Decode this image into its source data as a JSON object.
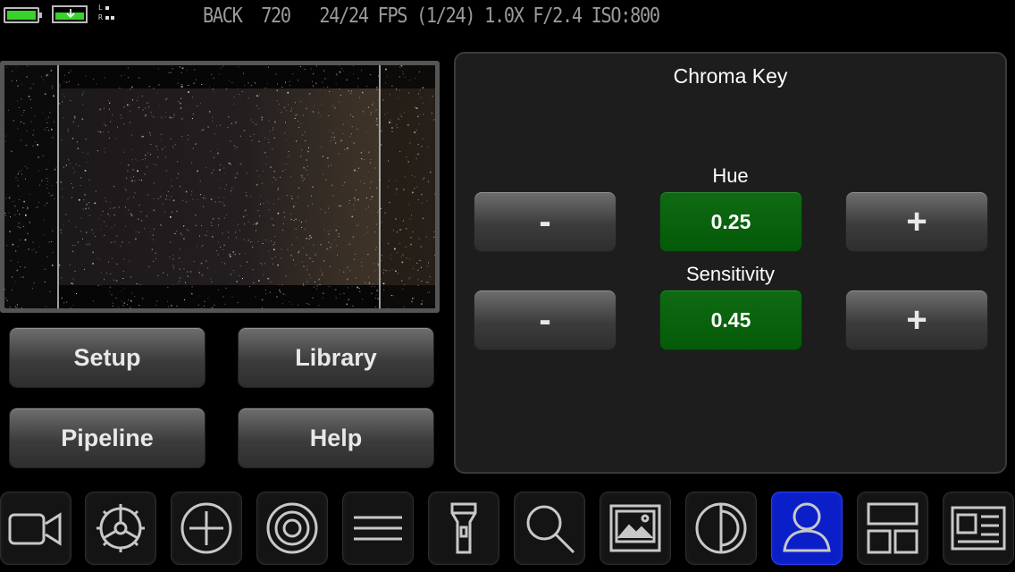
{
  "status_bar": {
    "battery_icon": "battery-icon",
    "storage_icon": "storage-icon",
    "audio_meter_icon": "audio-meter-icon",
    "audio_meter_labels": [
      "L",
      "R"
    ],
    "info_text": "BACK  720   24/24 FPS (1/24) 1.0X F/2.4 ISO:800",
    "colors": {
      "battery": "#39d12c",
      "storage": "#39d12c",
      "text": "#9a9a9a"
    }
  },
  "preview": {
    "name": "camera-preview"
  },
  "buttons": {
    "setup": "Setup",
    "library": "Library",
    "pipeline": "Pipeline",
    "help": "Help"
  },
  "chroma_key": {
    "title": "Chroma Key",
    "hue": {
      "label": "Hue",
      "value": "0.25",
      "decrement": "-",
      "increment": "+"
    },
    "sensitivity": {
      "label": "Sensitivity",
      "value": "0.45",
      "decrement": "-",
      "increment": "+"
    },
    "value_color": "#0a6410"
  },
  "toolbar": {
    "items": [
      {
        "icon": "video-camera-icon",
        "active": false
      },
      {
        "icon": "gear-icon",
        "active": false
      },
      {
        "icon": "plus-circle-icon",
        "active": false
      },
      {
        "icon": "target-icon",
        "active": false
      },
      {
        "icon": "menu-lines-icon",
        "active": false
      },
      {
        "icon": "flashlight-icon",
        "active": false
      },
      {
        "icon": "search-icon",
        "active": false
      },
      {
        "icon": "image-icon",
        "active": false
      },
      {
        "icon": "contrast-icon",
        "active": false
      },
      {
        "icon": "person-icon",
        "active": true
      },
      {
        "icon": "layout-icon",
        "active": false
      },
      {
        "icon": "article-icon",
        "active": false
      }
    ],
    "active_color": "#0b1fc8"
  }
}
